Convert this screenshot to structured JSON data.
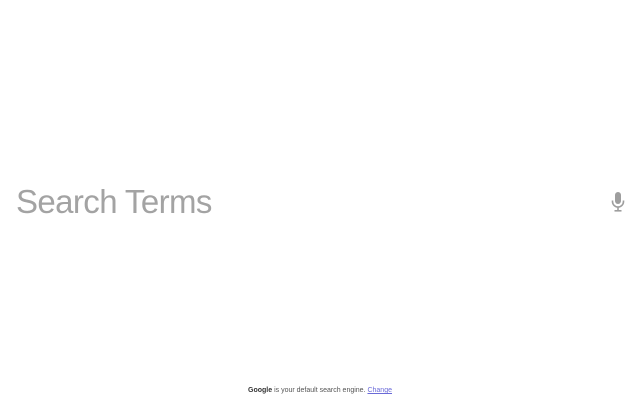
{
  "search": {
    "value": "",
    "placeholder": "Search Terms"
  },
  "mic": {
    "icon": "microphone-icon",
    "color": "#9e9e9e"
  },
  "footer": {
    "engine_name": "Google",
    "message": " is your default search engine. ",
    "change_link": "Change"
  }
}
